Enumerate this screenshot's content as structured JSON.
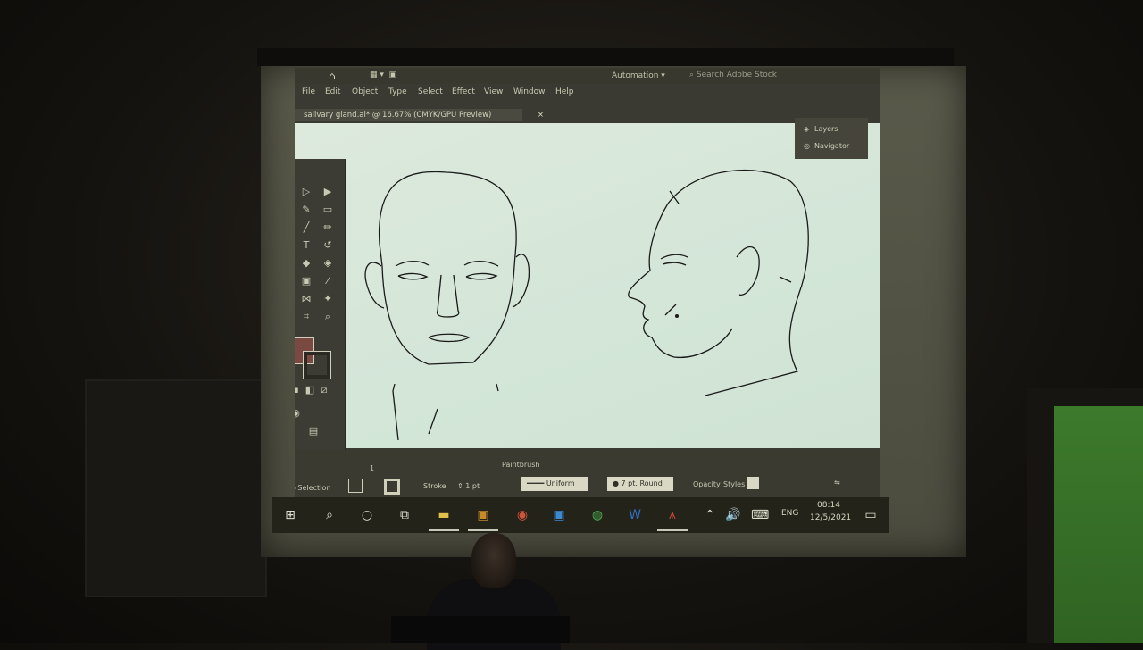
{
  "topbar": {
    "workspace_label": "Automation",
    "search_placeholder": "Search Adobe Stock"
  },
  "menu": [
    "File",
    "Edit",
    "Object",
    "Type",
    "Select",
    "Effect",
    "View",
    "Window",
    "Help"
  ],
  "document_tab": {
    "title": "salivary gland.ai* @ 16.67% (CMYK/GPU Preview)",
    "close": "×"
  },
  "panels": {
    "layers": "Layers",
    "navigator": "Navigator"
  },
  "control_bar": {
    "selection": "No Selection",
    "stroke_label": "Stroke",
    "stroke_value": "1 pt",
    "brush_label": "Paintbrush",
    "profile_value": "Uniform",
    "brush_value": "7 pt. Round",
    "opacity_label": "Opacity",
    "styles_label": "Styles",
    "page_number": "1"
  },
  "taskbar": {
    "language": "ENG",
    "time": "08:14",
    "date": "12/5/2021"
  },
  "icons": [
    "home-icon",
    "windows-start-icon",
    "search-icon",
    "cortana-icon",
    "task-view-icon",
    "file-explorer-icon",
    "illustrator-icon",
    "powerpoint-icon",
    "photoshop-icon",
    "chrome-icon",
    "word-icon",
    "acrobat-icon",
    "volume-icon",
    "keyboard-icon",
    "notification-icon",
    "layers-icon",
    "navigator-icon"
  ],
  "colors": {
    "fill_swatch": "#7a4a42",
    "canvas": "#d6e8d9",
    "app_chrome": "#3a3a32"
  }
}
